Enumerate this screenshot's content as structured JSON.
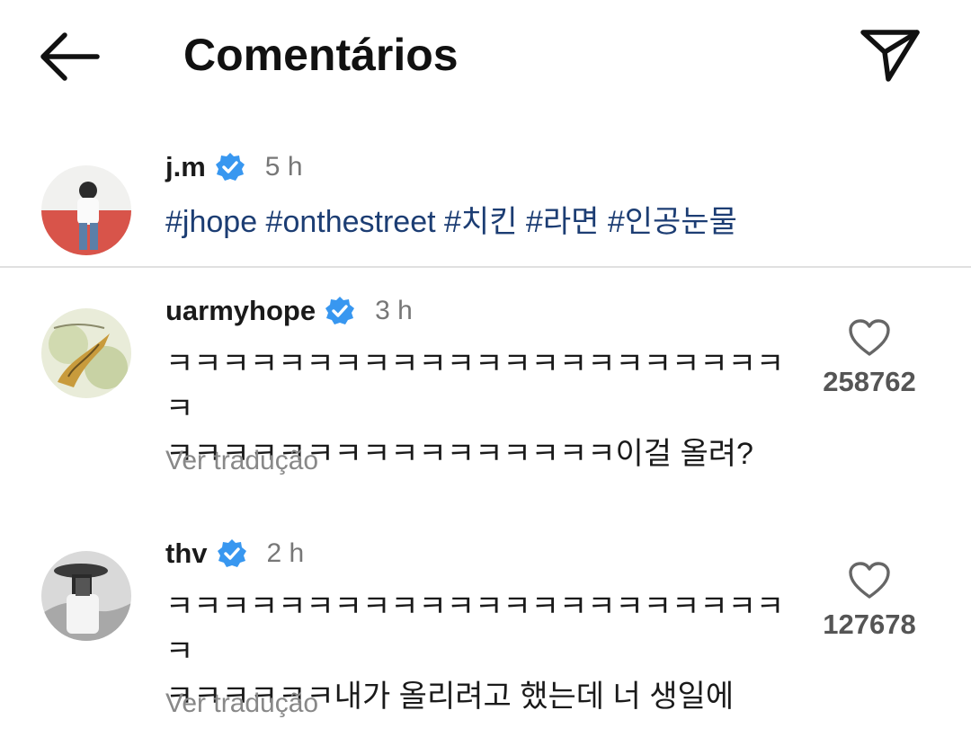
{
  "header": {
    "title": "Comentários"
  },
  "caption": {
    "username": "j.m",
    "time": "5 h",
    "text": "#jhope #onthestreet #치킨 #라면 #인공눈물"
  },
  "comments": [
    {
      "username": "uarmyhope",
      "time": "3 h",
      "line1": "ㅋㅋㅋㅋㅋㅋㅋㅋㅋㅋㅋㅋㅋㅋㅋㅋㅋㅋㅋㅋㅋㅋㅋ",
      "line2": "ㅋㅋㅋㅋㅋㅋㅋㅋㅋㅋㅋㅋㅋㅋㅋㅋ이걸 올려?",
      "translate": "Ver tradução",
      "likes": "258762"
    },
    {
      "username": "thv",
      "time": "2 h",
      "line1": "ㅋㅋㅋㅋㅋㅋㅋㅋㅋㅋㅋㅋㅋㅋㅋㅋㅋㅋㅋㅋㅋㅋㅋ",
      "line2": "ㅋㅋㅋㅋㅋㅋ내가 올리려고 했는데 너 생일에",
      "translate": "Ver tradução",
      "likes": "127678"
    }
  ],
  "icons": {
    "back": "arrow-left-icon",
    "send": "paper-plane-icon",
    "verified": "verified-badge-icon",
    "like": "heart-outline-icon"
  },
  "colors": {
    "verified": "#3897f0",
    "hashtag": "#1c3d73",
    "muted": "#888888"
  }
}
